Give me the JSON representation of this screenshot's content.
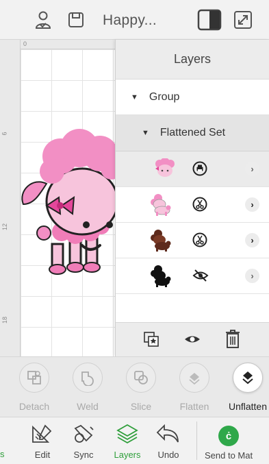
{
  "header": {
    "project_title": "Happy...",
    "icons": [
      "account-icon",
      "save-icon",
      "split-view-icon",
      "fullscreen-icon"
    ]
  },
  "canvas": {
    "ruler_top_labels": [
      "0"
    ],
    "ruler_left_labels": [
      "6",
      "12",
      "18"
    ]
  },
  "layers_panel": {
    "title": "Layers",
    "group_label": "Group",
    "flattened_set_label": "Flattened Set",
    "rows": [
      {
        "thumb": "pink-poodle-face",
        "action_icon": "print-icon",
        "selected": true
      },
      {
        "thumb": "pink-poodle-full",
        "action_icon": "cut-icon",
        "selected": false
      },
      {
        "thumb": "brown-poodle",
        "action_icon": "cut-icon",
        "selected": false
      },
      {
        "thumb": "black-poodle",
        "action_icon": "hidden-icon",
        "selected": false
      }
    ],
    "footer_icons": [
      "attach-icon",
      "visibility-icon",
      "delete-icon"
    ]
  },
  "actions": [
    {
      "label": "Detach",
      "icon": "detach-icon",
      "enabled": false
    },
    {
      "label": "Weld",
      "icon": "weld-icon",
      "enabled": false
    },
    {
      "label": "Slice",
      "icon": "slice-icon",
      "enabled": false
    },
    {
      "label": "Flatten",
      "icon": "flatten-icon",
      "enabled": false
    },
    {
      "label": "Unflatten",
      "icon": "unflatten-icon",
      "enabled": true
    }
  ],
  "nav": {
    "partial": "s",
    "edit": "Edit",
    "sync": "Sync",
    "layers": "Layers",
    "undo": "Undo",
    "send": "Send to Mat"
  },
  "colors": {
    "accent_green": "#2fa84a",
    "pink": "#f2a7cf",
    "hot_pink": "#e4479a",
    "brown": "#5e2a1c"
  }
}
